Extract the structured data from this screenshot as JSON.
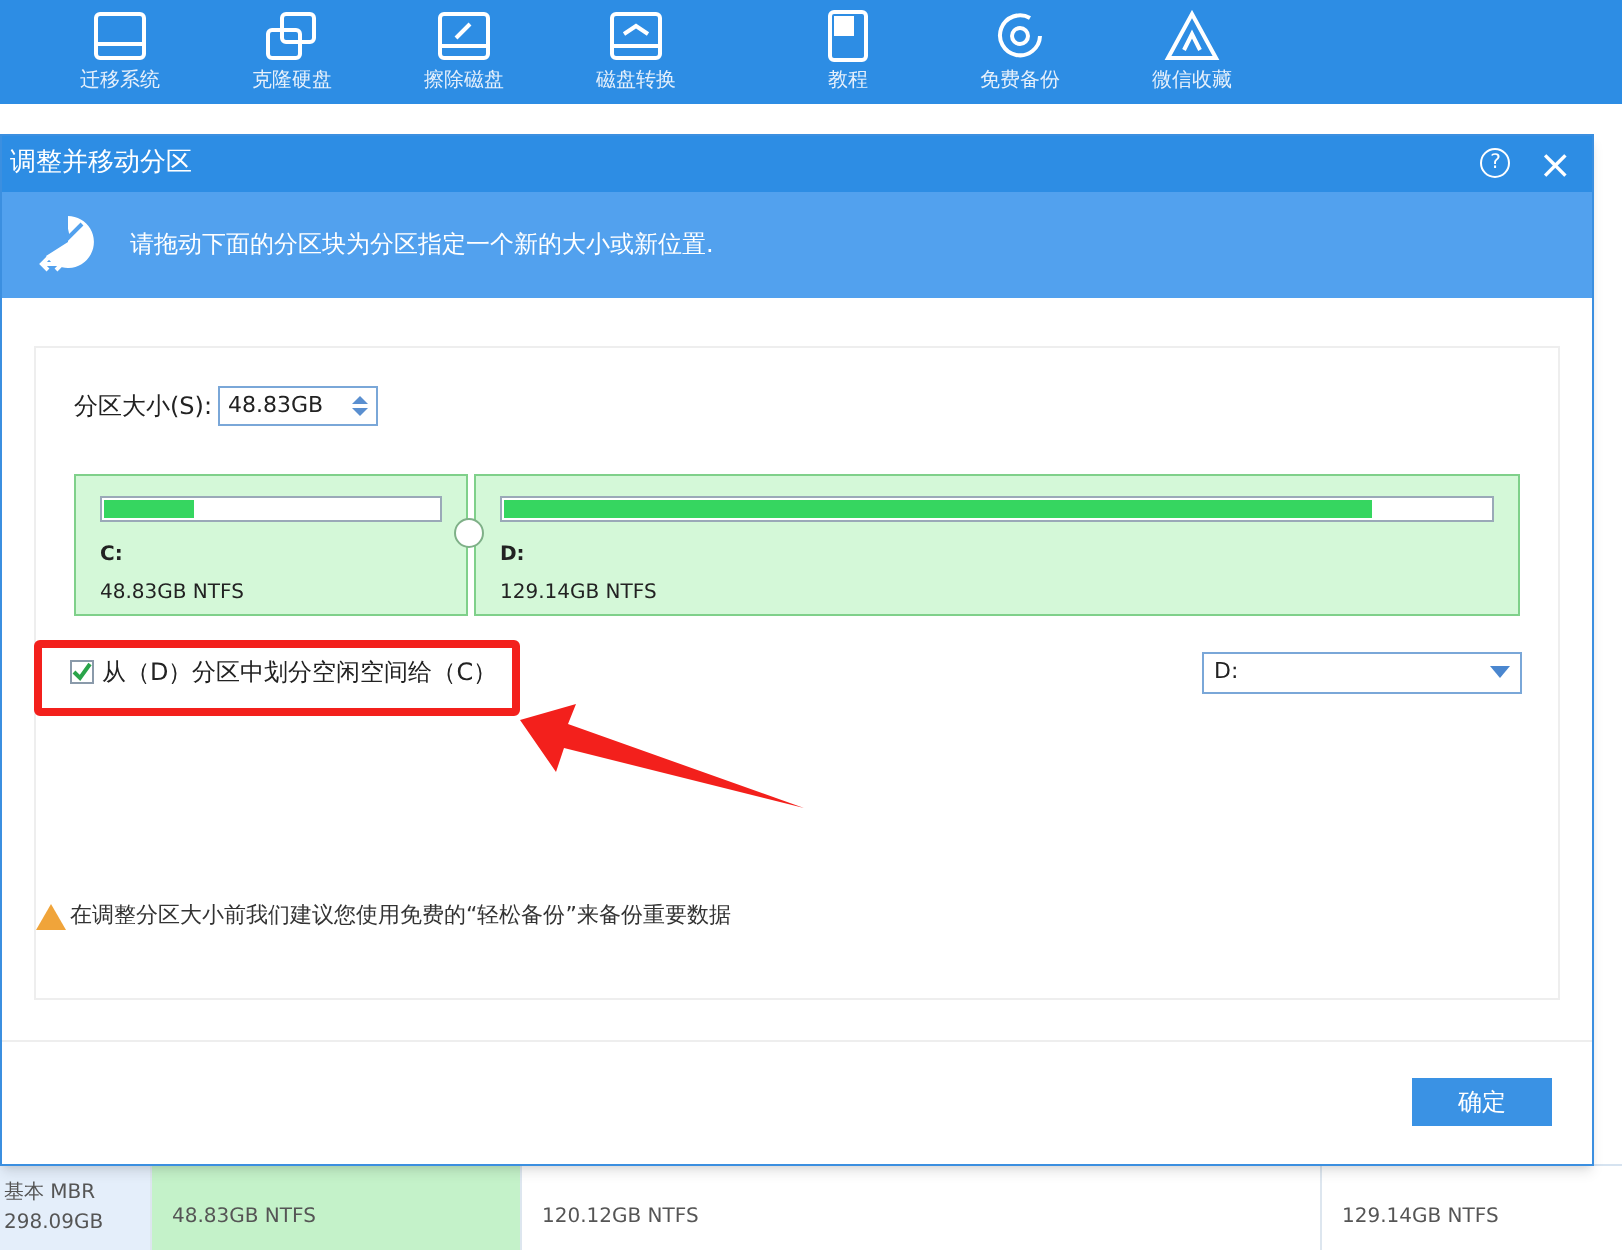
{
  "toolbar": {
    "items": [
      {
        "label": "迁移系统"
      },
      {
        "label": "克隆硬盘"
      },
      {
        "label": "擦除磁盘"
      },
      {
        "label": "磁盘转换"
      },
      {
        "label": "教程"
      },
      {
        "label": "免费备份"
      },
      {
        "label": "微信收藏"
      }
    ]
  },
  "dialog": {
    "title": "调整并移动分区",
    "help": "?",
    "close": "×",
    "banner": "请拖动下面的分区块为分区指定一个新的大小或新位置.",
    "size_label": "分区大小(S):",
    "size_value": "48.83GB",
    "partitions": [
      {
        "letter": "C:",
        "detail": "48.83GB NTFS",
        "level": 0.27
      },
      {
        "letter": "D:",
        "detail": "129.14GB NTFS",
        "level": 0.88
      }
    ],
    "allocate": {
      "label": "从（D）分区中划分空闲空间给（C）",
      "checked": true
    },
    "source_select": {
      "value": "D:"
    },
    "warning": "在调整分区大小前我们建议您使用免费的“轻松备份”来备份重要数据",
    "ok_button": "确定"
  },
  "disk_row": {
    "disk_type": "基本 MBR",
    "disk_size": "298.09GB",
    "cells": [
      {
        "detail": "48.83GB NTFS",
        "selected": true
      },
      {
        "detail": "120.12GB NTFS",
        "selected": false
      },
      {
        "detail": "129.14GB NTFS",
        "selected": false
      }
    ]
  }
}
